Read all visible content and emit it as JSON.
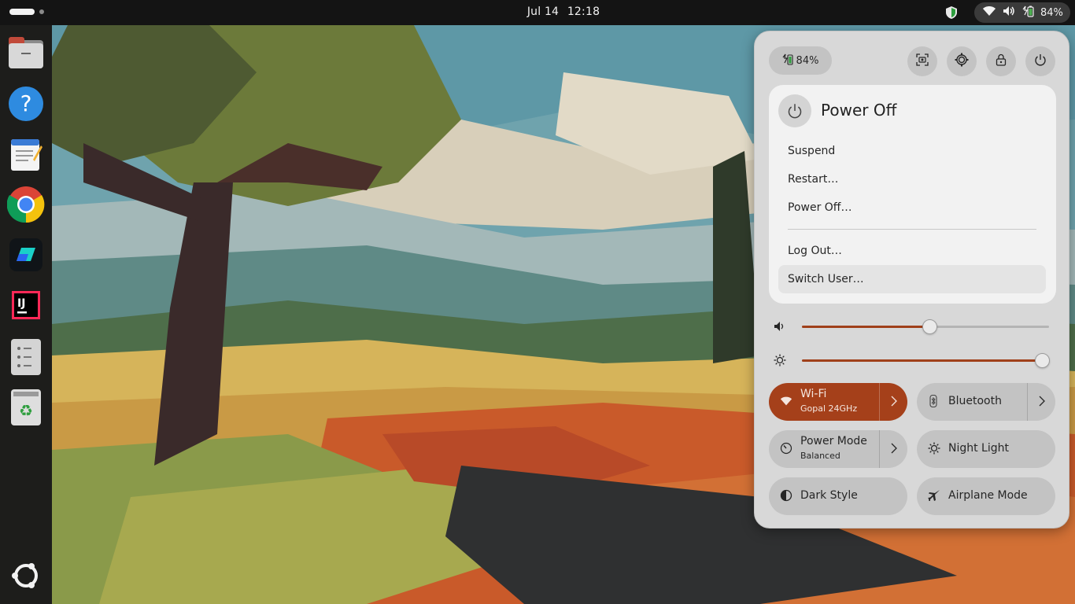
{
  "topbar": {
    "date": "Jul 14",
    "time": "12:18",
    "battery": "84%"
  },
  "dock": {
    "items": [
      "files-icon",
      "help-icon",
      "text-editor-icon",
      "chrome-icon",
      "app-icon",
      "intellij-icon",
      "app-grid-icon",
      "trash-icon"
    ],
    "show_apps": "ubuntu-logo-icon"
  },
  "quick_settings": {
    "battery": "84%",
    "power_menu": {
      "title": "Power Off",
      "items": [
        "Suspend",
        "Restart…",
        "Power Off…",
        "Log Out…",
        "Switch User…"
      ]
    },
    "sliders": {
      "volume": 0.52,
      "brightness": 1.0
    },
    "tiles": {
      "wifi": {
        "label": "Wi-Fi",
        "sub": "Gopal 24GHz",
        "active": true
      },
      "bluetooth": {
        "label": "Bluetooth"
      },
      "power_mode": {
        "label": "Power Mode",
        "sub": "Balanced"
      },
      "night_light": {
        "label": "Night Light"
      },
      "dark_style": {
        "label": "Dark Style"
      },
      "airplane_mode": {
        "label": "Airplane Mode"
      }
    }
  },
  "colors": {
    "accent": "#a5401a",
    "panel": "#d8d8d8",
    "topbar": "#141414"
  }
}
